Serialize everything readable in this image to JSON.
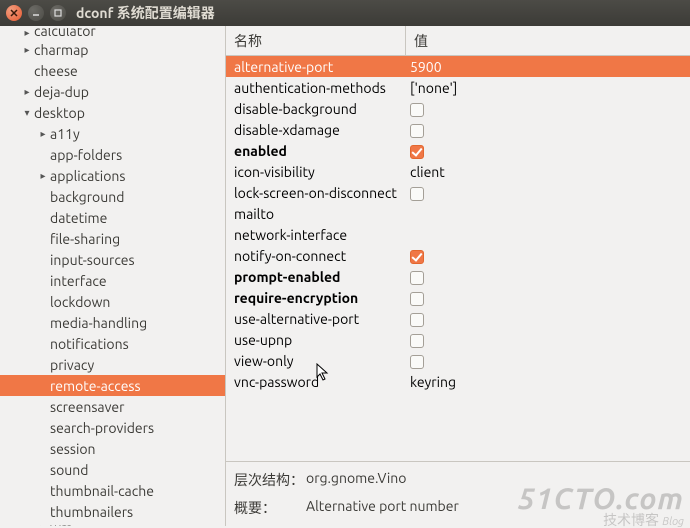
{
  "window": {
    "title": "dconf 系统配置编辑器"
  },
  "columns": {
    "name": "名称",
    "value": "值"
  },
  "tree": [
    {
      "label": "calculator",
      "depth": 1,
      "exp": "r",
      "cut": true
    },
    {
      "label": "charmap",
      "depth": 1,
      "exp": "r"
    },
    {
      "label": "cheese",
      "depth": 1,
      "exp": ""
    },
    {
      "label": "deja-dup",
      "depth": 1,
      "exp": "r"
    },
    {
      "label": "desktop",
      "depth": 1,
      "exp": "d"
    },
    {
      "label": "a11y",
      "depth": 2,
      "exp": "r"
    },
    {
      "label": "app-folders",
      "depth": 2,
      "exp": ""
    },
    {
      "label": "applications",
      "depth": 2,
      "exp": "r"
    },
    {
      "label": "background",
      "depth": 2,
      "exp": ""
    },
    {
      "label": "datetime",
      "depth": 2,
      "exp": ""
    },
    {
      "label": "file-sharing",
      "depth": 2,
      "exp": ""
    },
    {
      "label": "input-sources",
      "depth": 2,
      "exp": ""
    },
    {
      "label": "interface",
      "depth": 2,
      "exp": ""
    },
    {
      "label": "lockdown",
      "depth": 2,
      "exp": ""
    },
    {
      "label": "media-handling",
      "depth": 2,
      "exp": ""
    },
    {
      "label": "notifications",
      "depth": 2,
      "exp": ""
    },
    {
      "label": "privacy",
      "depth": 2,
      "exp": ""
    },
    {
      "label": "remote-access",
      "depth": 2,
      "exp": "",
      "sel": true
    },
    {
      "label": "screensaver",
      "depth": 2,
      "exp": ""
    },
    {
      "label": "search-providers",
      "depth": 2,
      "exp": ""
    },
    {
      "label": "session",
      "depth": 2,
      "exp": ""
    },
    {
      "label": "sound",
      "depth": 2,
      "exp": ""
    },
    {
      "label": "thumbnail-cache",
      "depth": 2,
      "exp": ""
    },
    {
      "label": "thumbnailers",
      "depth": 2,
      "exp": ""
    },
    {
      "label": "wm",
      "depth": 2,
      "exp": "r",
      "cut": true
    }
  ],
  "settings": [
    {
      "name": "alternative-port",
      "value": "5900",
      "sel": true
    },
    {
      "name": "authentication-methods",
      "value": "['none']"
    },
    {
      "name": "disable-background",
      "check": false
    },
    {
      "name": "disable-xdamage",
      "check": false
    },
    {
      "name": "enabled",
      "check": true,
      "bold": true
    },
    {
      "name": "icon-visibility",
      "value": "client"
    },
    {
      "name": "lock-screen-on-disconnect",
      "check": false
    },
    {
      "name": "mailto",
      "value": ""
    },
    {
      "name": "network-interface",
      "value": ""
    },
    {
      "name": "notify-on-connect",
      "check": true
    },
    {
      "name": "prompt-enabled",
      "check": false,
      "bold": true
    },
    {
      "name": "require-encryption",
      "check": false,
      "bold": true
    },
    {
      "name": "use-alternative-port",
      "check": false
    },
    {
      "name": "use-upnp",
      "check": false
    },
    {
      "name": "view-only",
      "check": false
    },
    {
      "name": "vnc-password",
      "value": "keyring"
    }
  ],
  "footer": {
    "path_label": "层次结构：",
    "path_value": "org.gnome.Vino",
    "summary_label": "概要：",
    "summary_value": "Alternative port number"
  },
  "watermark": {
    "line1": "51CTO.com",
    "line2": "技术博客",
    "line3": "Blog"
  }
}
